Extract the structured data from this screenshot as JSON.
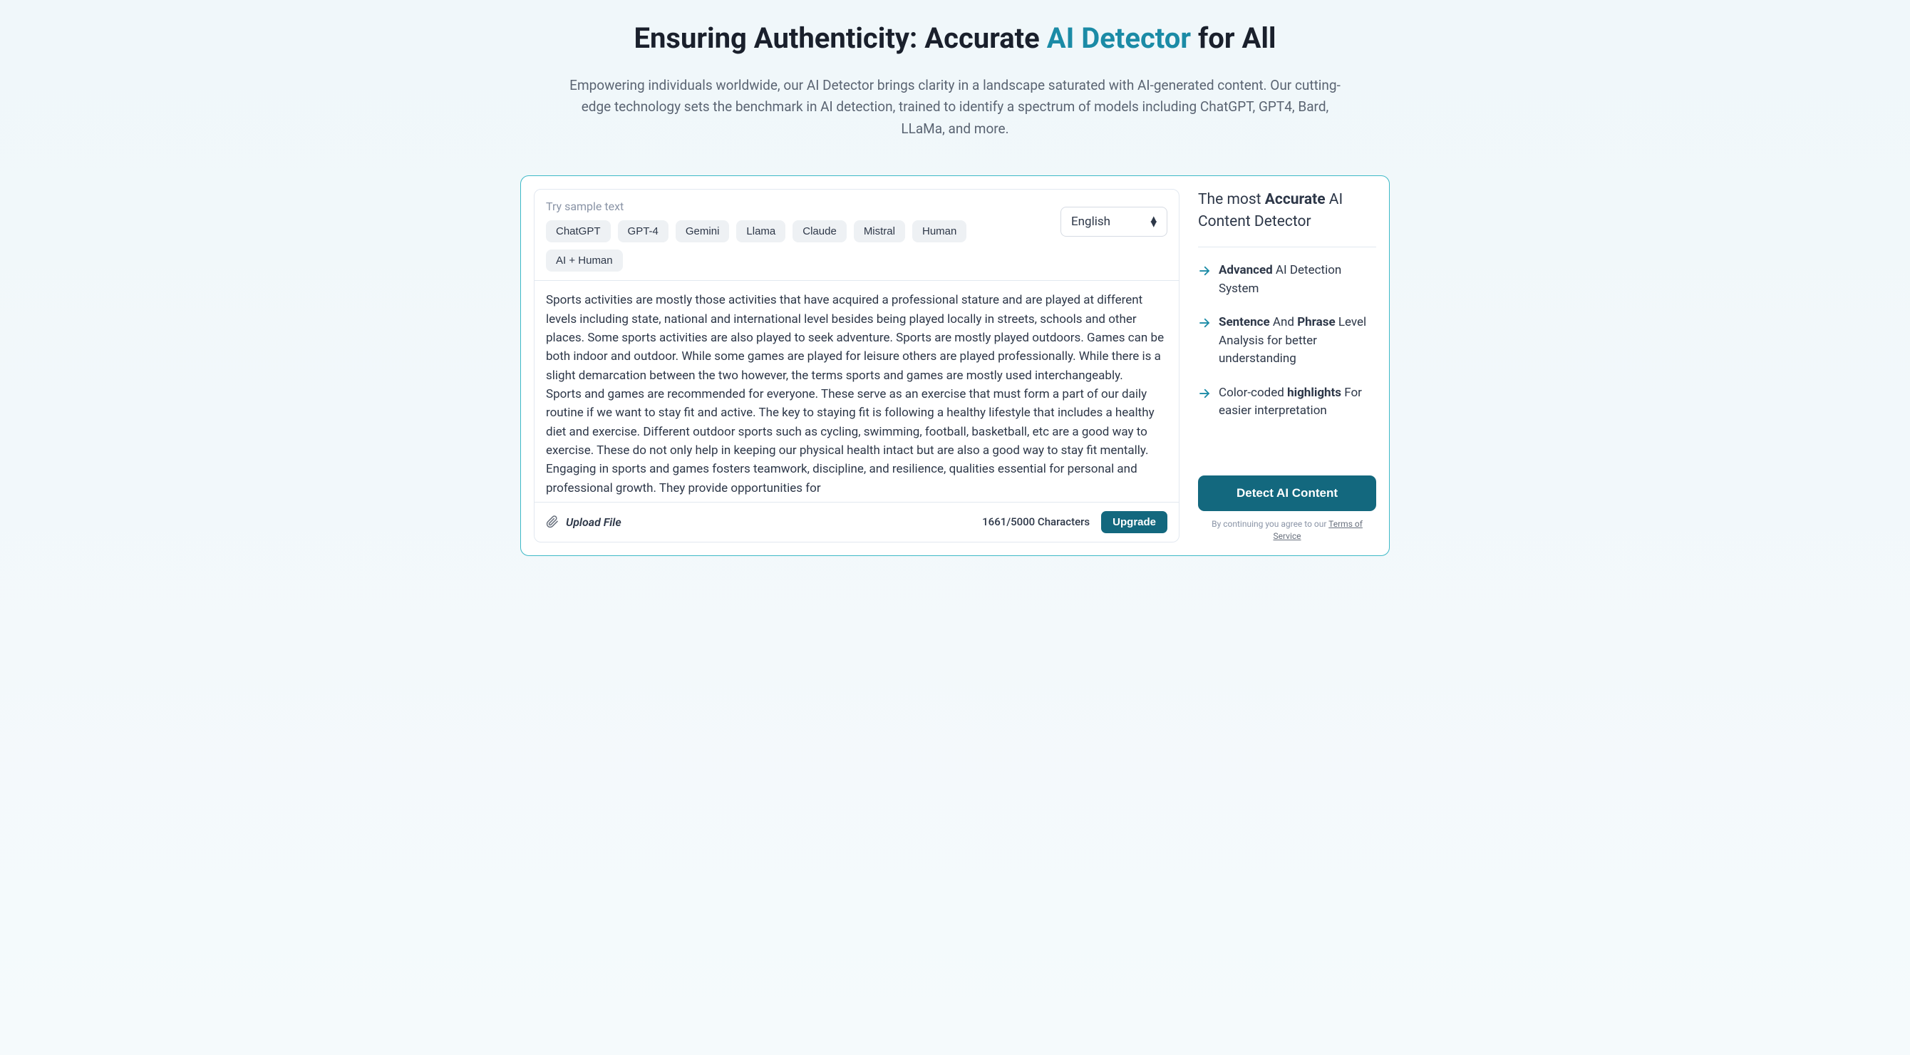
{
  "header": {
    "title_pre": "Ensuring Authenticity: Accurate ",
    "title_accent": "AI Detector",
    "title_post": " for All",
    "subtitle": "Empowering individuals worldwide, our AI Detector brings clarity in a landscape saturated with AI-generated content. Our cutting-edge technology sets the benchmark in AI detection, trained to identify a spectrum of models including ChatGPT, GPT4, Bard, LLaMa, and more."
  },
  "input": {
    "sample_label": "Try sample text",
    "chips": [
      "ChatGPT",
      "GPT-4",
      "Gemini",
      "Llama",
      "Claude",
      "Mistral",
      "Human",
      "AI + Human"
    ],
    "language": "English",
    "content": "Sports activities are mostly those activities that have acquired a professional stature and are played at different levels including state, national and international level besides being played locally in streets, schools and other places. Some sports activities are also played to seek adventure. Sports are mostly played outdoors. Games can be both indoor and outdoor. While some games are played for leisure others are played professionally. While there is a slight demarcation between the two however, the terms sports and games are mostly used interchangeably.\nSports and games are recommended for everyone. These serve as an exercise that must form a part of our daily routine if we want to stay fit and active. The key to staying fit is following a healthy lifestyle that includes a healthy diet and exercise. Different outdoor sports such as cycling, swimming, football, basketball, etc are a good way to exercise. These do not only help in keeping our physical health intact but are also a good way to stay fit mentally. Engaging in sports and games fosters teamwork, discipline, and resilience, qualities essential for personal and professional growth. They provide opportunities for",
    "upload_label": "Upload File",
    "char_count": "1661/5000 Characters",
    "upgrade_label": "Upgrade"
  },
  "sidebar": {
    "title_pre": "The most ",
    "title_bold": "Accurate",
    "title_post": " AI Content Detector",
    "features": [
      {
        "bold1": "Advanced",
        "rest": " AI Detection System"
      },
      {
        "bold1": "Sentence",
        "mid": " And ",
        "bold2": "Phrase",
        "rest": " Level Analysis for better understanding"
      },
      {
        "pre": "Color-coded ",
        "bold1": "highlights",
        "rest": " For easier interpretation"
      }
    ],
    "detect_label": "Detect AI Content",
    "tos_pre": "By continuing you agree to our ",
    "tos_link": "Terms of Service"
  }
}
